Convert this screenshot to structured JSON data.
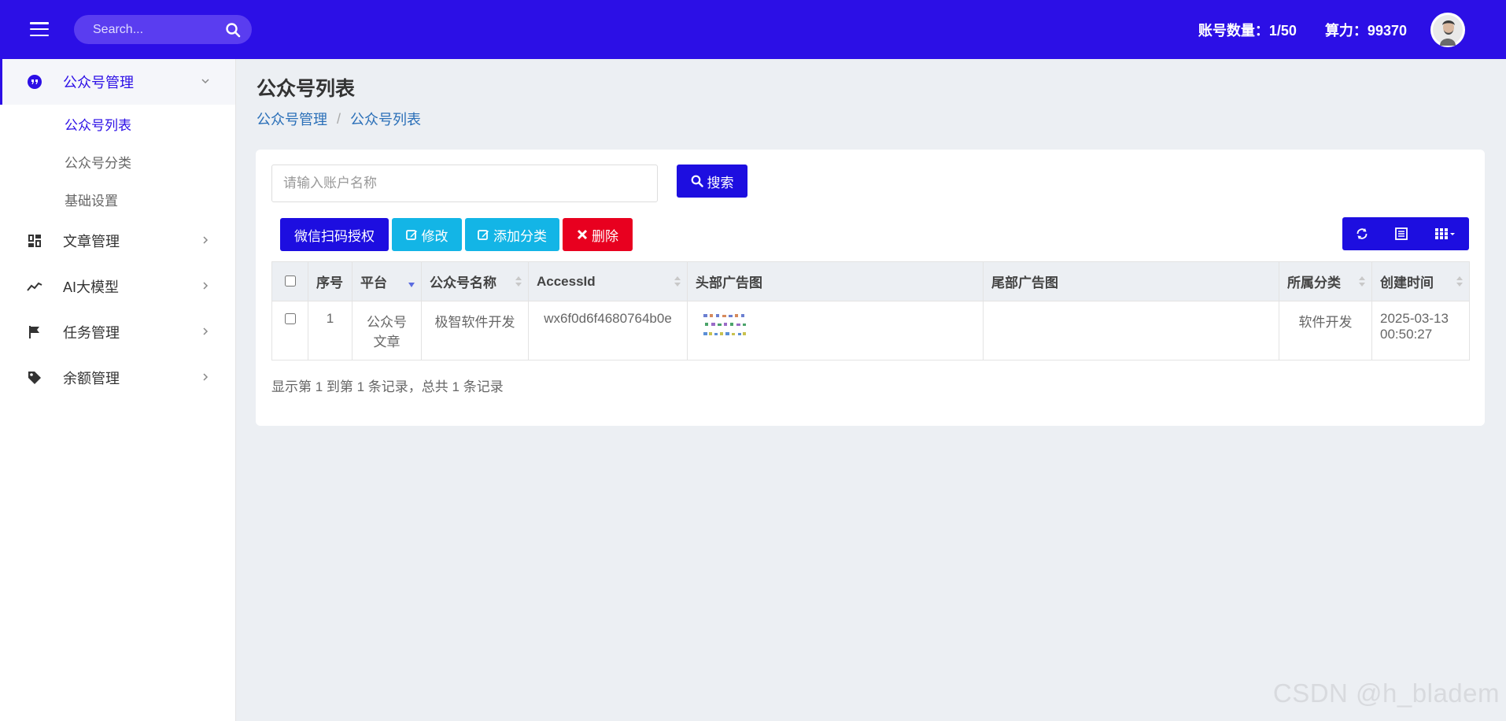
{
  "header": {
    "search_placeholder": "Search...",
    "account_count": "账号数量：1/50",
    "compute_power": "算力：99370"
  },
  "sidebar": {
    "groups": [
      {
        "label": "公众号管理",
        "icon": "wechat-official-icon",
        "expanded": true,
        "children": [
          {
            "label": "公众号列表",
            "active": true
          },
          {
            "label": "公众号分类",
            "active": false
          },
          {
            "label": "基础设置",
            "active": false
          }
        ]
      },
      {
        "label": "文章管理",
        "icon": "article-dashboard-icon"
      },
      {
        "label": "AI大模型",
        "icon": "trend-line-icon"
      },
      {
        "label": "任务管理",
        "icon": "flag-icon"
      },
      {
        "label": "余额管理",
        "icon": "tag-icon"
      }
    ]
  },
  "main": {
    "title": "公众号列表",
    "breadcrumb": [
      "公众号管理",
      "公众号列表"
    ],
    "search_input_placeholder": "请输入账户名称",
    "search_button": "搜索",
    "actions": {
      "wechat_auth": "微信扫码授权",
      "edit": "修改",
      "add_category": "添加分类",
      "delete": "删除"
    },
    "table": {
      "columns": [
        "序号",
        "平台",
        "公众号名称",
        "AccessId",
        "头部广告图",
        "尾部广告图",
        "所属分类",
        "创建时间"
      ],
      "rows": [
        {
          "index": "1",
          "platform": "公众号文章",
          "name": "极智软件开发",
          "access_id": "wx6f0d6f4680764b0e",
          "header_ad": "",
          "footer_ad": "",
          "category": "软件开发",
          "created": "2025-03-13 00:50:27"
        }
      ]
    },
    "pager_info": "显示第 1 到第 1 条记录，总共 1 条记录"
  },
  "watermark": "CSDN @h_bladem",
  "colors": {
    "primary": "#2c0fe6",
    "info": "#13b5e6",
    "danger": "#e8001f",
    "link": "#2a6fb8"
  }
}
